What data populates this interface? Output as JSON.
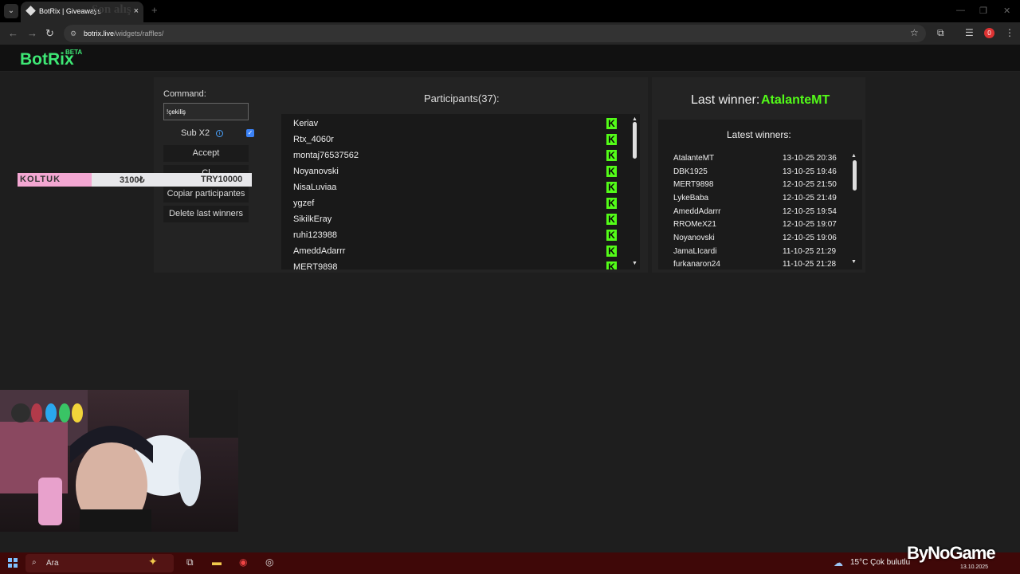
{
  "browser": {
    "tab_title": "BotRix | Giveaways",
    "ghost_text": "Son alış",
    "url_host": "botrix.live",
    "url_path": "/widgets/raffles/",
    "profile_initial": "0"
  },
  "app": {
    "logo": "BotRix",
    "beta": "BETA"
  },
  "command": {
    "label": "Command:",
    "value": "!çekiliş"
  },
  "options": {
    "sub_label": "Sub X2",
    "sub_checked": true
  },
  "buttons": {
    "accept": "Accept",
    "hidden_partial": "Cl",
    "copy": "Copiar participantes",
    "delete": "Delete last winners"
  },
  "participants": {
    "title": "Participants(37):",
    "platform": "kick",
    "names": [
      "Keriav",
      "Rtx_4060r",
      "montaj76537562",
      "Noyanovski",
      "NisaLuviaa",
      "ygzef",
      "SikilkEray",
      "ruhi123988",
      "AmeddAdarrr",
      "MERT9898"
    ]
  },
  "last_winner": {
    "label": "Last winner:",
    "name": "AtalanteMT"
  },
  "latest_winners": {
    "title": "Latest winners:",
    "rows": [
      {
        "name": "AtalanteMT",
        "date": "13-10-25 20:36"
      },
      {
        "name": "DBK1925",
        "date": "13-10-25 19:46"
      },
      {
        "name": "MERT9898",
        "date": "12-10-25 21:50"
      },
      {
        "name": "LykeBaba",
        "date": "12-10-25 21:49"
      },
      {
        "name": "AmeddAdarrr",
        "date": "12-10-25 19:54"
      },
      {
        "name": "RROMeX21",
        "date": "12-10-25 19:07"
      },
      {
        "name": "Noyanovski",
        "date": "12-10-25 19:06"
      },
      {
        "name": "JamaLIcardi",
        "date": "11-10-25 21:29"
      },
      {
        "name": "furkanaron24",
        "date": "11-10-25 21:28"
      }
    ]
  },
  "overlay": {
    "item": "KOLTUK",
    "price": "3100₺",
    "goal": "TRY10000"
  },
  "taskbar": {
    "search": "Ara",
    "weather": "15°C  Çok bulutlu",
    "date": "13.10.2025"
  },
  "watermark": "ByNoGame"
}
